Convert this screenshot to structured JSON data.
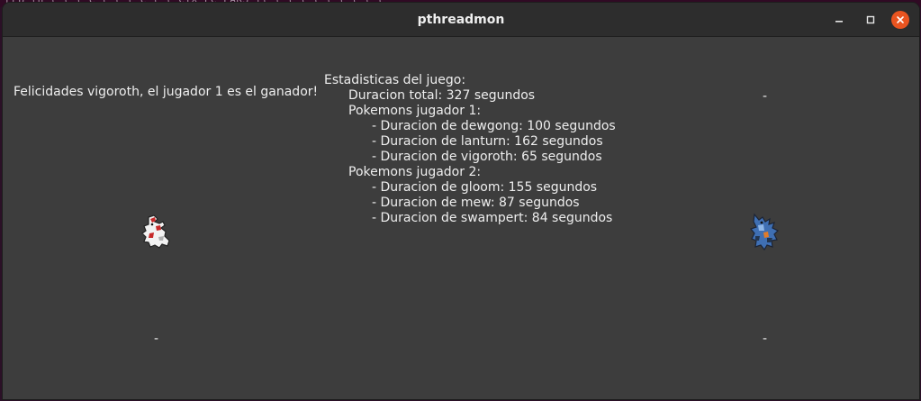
{
  "window": {
    "title": "pthreadmon"
  },
  "game": {
    "winner_message": "Felicidades vigoroth, el jugador 1 es el ganador!",
    "player1_top_label": "",
    "player2_top_label": "-",
    "player1_bottom_label": "-",
    "player2_bottom_label": "-",
    "player1_sprite": "pokemon-sprite-player1",
    "player2_sprite": "pokemon-sprite-player2"
  },
  "stats": {
    "heading": "Estadisticas del juego:",
    "total_duration": "Duracion total: 327 segundos",
    "player1": {
      "heading": "Pokemons jugador 1:",
      "items": [
        "- Duracion de dewgong: 100 segundos",
        "- Duracion de lanturn: 162 segundos",
        "- Duracion de vigoroth: 65 segundos"
      ]
    },
    "player2": {
      "heading": "Pokemons jugador 2:",
      "items": [
        "- Duracion de gloom: 155 segundos",
        "- Duracion de mew: 87 segundos",
        "- Duracion de swampert: 84 segundos"
      ]
    }
  },
  "colors": {
    "close_button": "#e95420",
    "window_bg": "#3d3d3d",
    "titlebar_bg": "#2d2d2d"
  }
}
